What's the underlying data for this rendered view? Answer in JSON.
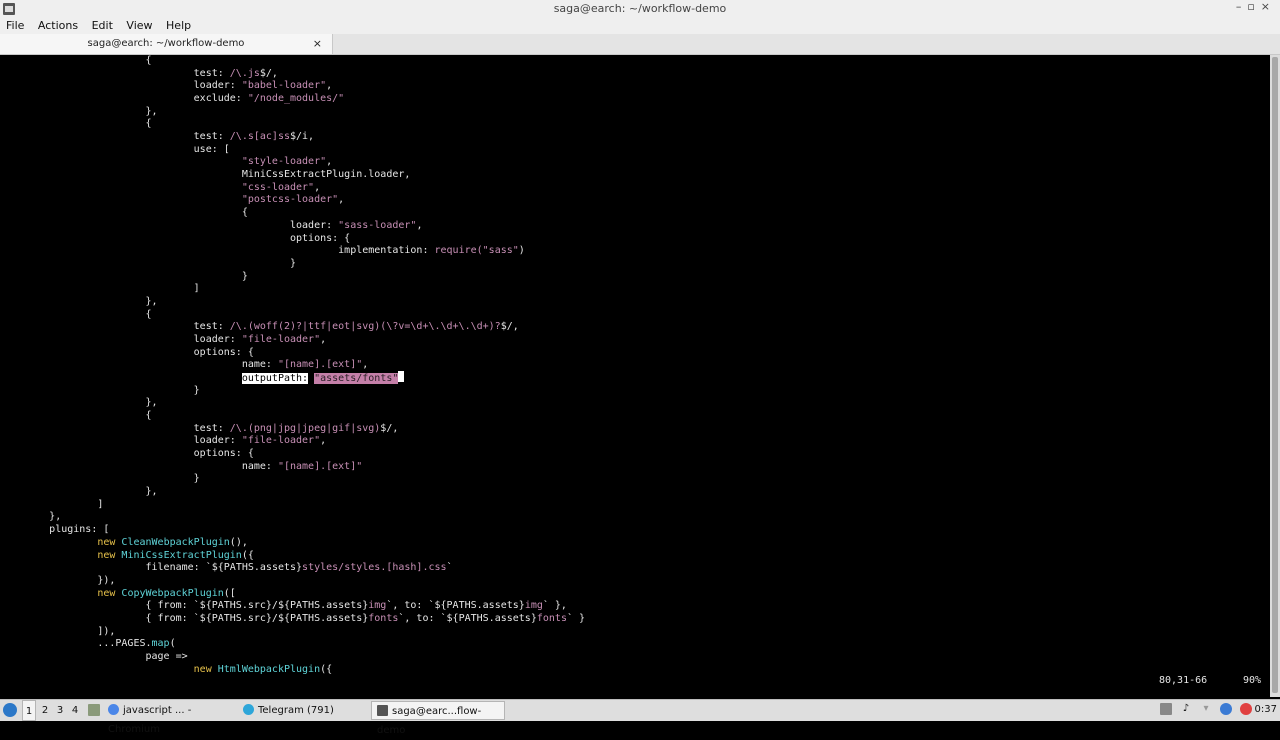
{
  "window": {
    "title": "saga@earch: ~/workflow-demo",
    "controls": [
      "–",
      "▫",
      "×"
    ]
  },
  "menu": [
    "File",
    "Actions",
    "Edit",
    "View",
    "Help"
  ],
  "tab": {
    "title": "saga@earch: ~/workflow-demo",
    "close": "×"
  },
  "editor": {
    "lines": [
      [
        {
          "t": "\t\t\t{"
        }
      ],
      [
        {
          "t": "\t\t\t\ttest: "
        },
        {
          "t": "/\\.",
          "c": "r"
        },
        {
          "t": "js",
          "c": "s"
        },
        {
          "t": "$/,"
        }
      ],
      [
        {
          "t": "\t\t\t\tloader: "
        },
        {
          "t": "\"babel-loader\"",
          "c": "s"
        },
        {
          "t": ","
        }
      ],
      [
        {
          "t": "\t\t\t\texclude: "
        },
        {
          "t": "\"/node_modules/\"",
          "c": "s"
        }
      ],
      [
        {
          "t": "\t\t\t},"
        }
      ],
      [
        {
          "t": "\t\t\t{"
        }
      ],
      [
        {
          "t": "\t\t\t\ttest: "
        },
        {
          "t": "/\\.",
          "c": "r"
        },
        {
          "t": "s[ac]ss",
          "c": "s"
        },
        {
          "t": "$/i,"
        }
      ],
      [
        {
          "t": "\t\t\t\tuse: ["
        }
      ],
      [
        {
          "t": "\t\t\t\t\t"
        },
        {
          "t": "\"style-loader\"",
          "c": "s"
        },
        {
          "t": ","
        }
      ],
      [
        {
          "t": "\t\t\t\t\tMiniCssExtractPlugin.loader,"
        }
      ],
      [
        {
          "t": "\t\t\t\t\t"
        },
        {
          "t": "\"css-loader\"",
          "c": "s"
        },
        {
          "t": ","
        }
      ],
      [
        {
          "t": "\t\t\t\t\t"
        },
        {
          "t": "\"postcss-loader\"",
          "c": "s"
        },
        {
          "t": ","
        }
      ],
      [
        {
          "t": "\t\t\t\t\t{"
        }
      ],
      [
        {
          "t": "\t\t\t\t\t\tloader: "
        },
        {
          "t": "\"sass-loader\"",
          "c": "s"
        },
        {
          "t": ","
        }
      ],
      [
        {
          "t": "\t\t\t\t\t\toptions: {"
        }
      ],
      [
        {
          "t": "\t\t\t\t\t\t\timplementation: "
        },
        {
          "t": "require(",
          "c": "s"
        },
        {
          "t": "\"sass\"",
          "c": "s"
        },
        {
          "t": ")"
        }
      ],
      [
        {
          "t": "\t\t\t\t\t\t}"
        }
      ],
      [
        {
          "t": "\t\t\t\t\t}"
        }
      ],
      [
        {
          "t": "\t\t\t\t]"
        }
      ],
      [
        {
          "t": "\t\t\t},"
        }
      ],
      [
        {
          "t": "\t\t\t{"
        }
      ],
      [
        {
          "t": "\t\t\t\ttest: "
        },
        {
          "t": "/\\.",
          "c": "r"
        },
        {
          "t": "(woff(2)?|ttf|eot|svg)(\\?v=\\d+\\.\\d+\\.\\d+)?",
          "c": "s"
        },
        {
          "t": "$/,"
        }
      ],
      [
        {
          "t": "\t\t\t\tloader: "
        },
        {
          "t": "\"file-loader\"",
          "c": "s"
        },
        {
          "t": ","
        }
      ],
      [
        {
          "t": "\t\t\t\toptions: {"
        }
      ],
      [
        {
          "t": "\t\t\t\t\tname: "
        },
        {
          "t": "\"[name].[ext]\"",
          "c": "s"
        },
        {
          "t": ","
        }
      ],
      [
        {
          "t": "\t\t\t\t\t"
        },
        {
          "t": "outputPath:",
          "c": "hl-n"
        },
        {
          "t": " "
        },
        {
          "t": "\"assets/fonts\"",
          "c": "hl-v"
        },
        {
          "t": "",
          "c": "cursor"
        }
      ],
      [
        {
          "t": "\t\t\t\t}"
        }
      ],
      [
        {
          "t": "\t\t\t},"
        }
      ],
      [
        {
          "t": "\t\t\t{"
        }
      ],
      [
        {
          "t": "\t\t\t\ttest: "
        },
        {
          "t": "/\\.",
          "c": "r"
        },
        {
          "t": "(png|jpg|jpeg|gif|svg)",
          "c": "s"
        },
        {
          "t": "$/,"
        }
      ],
      [
        {
          "t": "\t\t\t\tloader: "
        },
        {
          "t": "\"file-loader\"",
          "c": "s"
        },
        {
          "t": ","
        }
      ],
      [
        {
          "t": "\t\t\t\toptions: {"
        }
      ],
      [
        {
          "t": "\t\t\t\t\tname: "
        },
        {
          "t": "\"[name].[ext]\"",
          "c": "s"
        }
      ],
      [
        {
          "t": "\t\t\t\t}"
        }
      ],
      [
        {
          "t": "\t\t\t},"
        }
      ],
      [
        {
          "t": "\t\t]"
        }
      ],
      [
        {
          "t": "\t},"
        }
      ],
      [
        {
          "t": "\tplugins: ["
        }
      ],
      [
        {
          "t": "\t\t"
        },
        {
          "t": "new ",
          "c": "k"
        },
        {
          "t": "CleanWebpackPlugin",
          "c": "c"
        },
        {
          "t": "(),"
        }
      ],
      [
        {
          "t": "\t\t"
        },
        {
          "t": "new ",
          "c": "k"
        },
        {
          "t": "MiniCssExtractPlugin",
          "c": "c"
        },
        {
          "t": "({"
        }
      ],
      [
        {
          "t": "\t\t\tfilename: "
        },
        {
          "t": "`${PATHS.assets}"
        },
        {
          "t": "styles/styles.[hash].css",
          "c": "s"
        },
        {
          "t": "`"
        }
      ],
      [
        {
          "t": "\t\t}),"
        }
      ],
      [
        {
          "t": "\t\t"
        },
        {
          "t": "new ",
          "c": "k"
        },
        {
          "t": "CopyWebpackPlugin",
          "c": "c"
        },
        {
          "t": "(["
        }
      ],
      [
        {
          "t": "\t\t\t{ from: `${PATHS.src}/${PATHS.assets}"
        },
        {
          "t": "img",
          "c": "s"
        },
        {
          "t": "`, to: `${PATHS.assets}"
        },
        {
          "t": "img",
          "c": "s"
        },
        {
          "t": "` },"
        }
      ],
      [
        {
          "t": "\t\t\t{ from: `${PATHS.src}/${PATHS.assets}"
        },
        {
          "t": "fonts",
          "c": "s"
        },
        {
          "t": "`, to: `${PATHS.assets}"
        },
        {
          "t": "fonts",
          "c": "s"
        },
        {
          "t": "` }"
        }
      ],
      [
        {
          "t": "\t\t]),"
        }
      ],
      [
        {
          "t": "\t\t...PAGES."
        },
        {
          "t": "map",
          "c": "c"
        },
        {
          "t": "("
        }
      ],
      [
        {
          "t": "\t\t\tpage =>"
        }
      ],
      [
        {
          "t": "\t\t\t\t"
        },
        {
          "t": "new ",
          "c": "k"
        },
        {
          "t": "HtmlWebpackPlugin",
          "c": "c"
        },
        {
          "t": "({"
        }
      ]
    ],
    "status_position": "80,31-66",
    "status_percent": "90%"
  },
  "taskbar": {
    "workspaces": [
      "1",
      "2",
      "3",
      "4"
    ],
    "active_workspace": "1",
    "tasks": [
      {
        "label": "javascript ... - Chromium",
        "icon": "chromium-icon"
      },
      {
        "label": "Telegram (791)",
        "icon": "telegram-icon"
      },
      {
        "label": "saga@earc...flow-demo",
        "icon": "terminal-icon"
      }
    ],
    "clock": "0:37"
  }
}
